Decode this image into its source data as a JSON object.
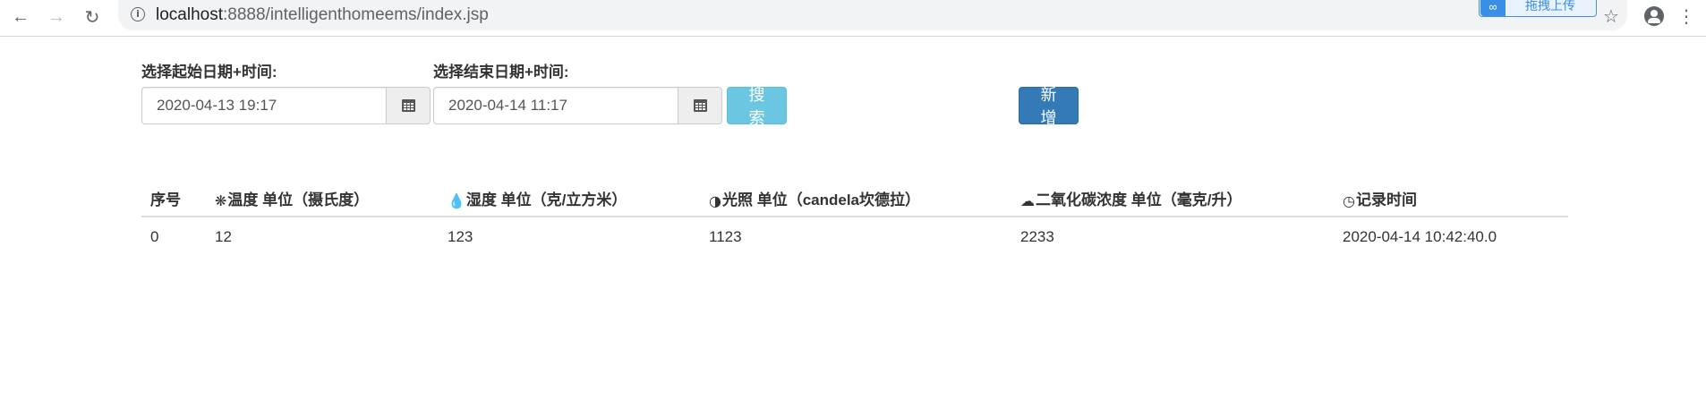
{
  "browser": {
    "url_host": "localhost",
    "url_rest": ":8888/intelligenthomeems/index.jsp",
    "extension_label": "拖拽上传",
    "icons": {
      "back": "arrow-left-icon",
      "forward": "arrow-right-icon",
      "reload": "reload-icon",
      "info": "info-icon",
      "star": "star-icon",
      "account": "account-icon",
      "menu": "kebab-menu-icon"
    }
  },
  "filters": {
    "start_label": "选择起始日期+时间:",
    "start_value": "2020-04-13 19:17",
    "end_label": "选择结束日期+时间:",
    "end_value": "2020-04-14 11:17",
    "search_button": "搜索",
    "add_button": "新增"
  },
  "table": {
    "columns": [
      {
        "label": "序号",
        "icon": ""
      },
      {
        "label": "温度 单位（摄氏度）",
        "icon": "asterisk-icon"
      },
      {
        "label": "湿度 单位（克/立方米）",
        "icon": "tint-icon"
      },
      {
        "label": "光照 单位（candela坎德拉）",
        "icon": "adjust-icon"
      },
      {
        "label": "二氧化碳浓度 单位（毫克/升）",
        "icon": "cloud-icon"
      },
      {
        "label": "记录时间",
        "icon": "dashboard-icon"
      }
    ],
    "rows": [
      [
        "0",
        "12",
        "123",
        "1123",
        "2233",
        "2020-04-14 10:42:40.0"
      ]
    ]
  },
  "colors": {
    "search_button": "#5bc0de",
    "add_button": "#337ab7"
  }
}
